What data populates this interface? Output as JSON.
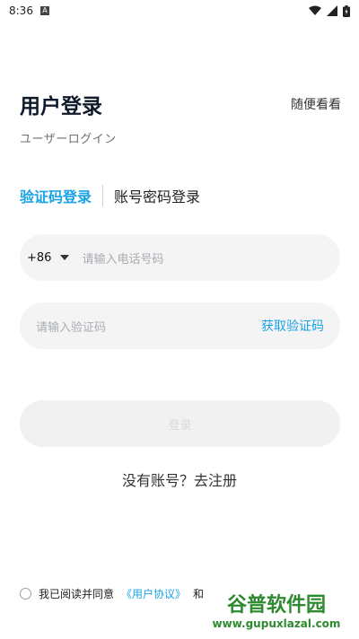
{
  "status_bar": {
    "time": "8:36",
    "notif_letter": "A"
  },
  "header": {
    "title": "用户登录",
    "browse_label": "随便看看",
    "subtitle": "ユーザーログイン"
  },
  "tabs": [
    {
      "label": "验证码登录",
      "active": true
    },
    {
      "label": "账号密码登录",
      "active": false
    }
  ],
  "phone": {
    "country_code": "+86",
    "placeholder": "请输入电话号码"
  },
  "code": {
    "placeholder": "请输入验证码",
    "get_code_label": "获取验证码"
  },
  "login": {
    "label": "登录"
  },
  "register": {
    "label": "没有账号？去注册"
  },
  "agreement": {
    "prefix": "我已阅读并同意",
    "user_agreement": "《用户协议》",
    "and": "和"
  },
  "watermark": {
    "text": "谷普软件园",
    "url": "www.gupuxlazal.com"
  },
  "colors": {
    "accent": "#1aa2e6",
    "field_bg": "#f4f4f5",
    "title": "#0f1a2b"
  }
}
